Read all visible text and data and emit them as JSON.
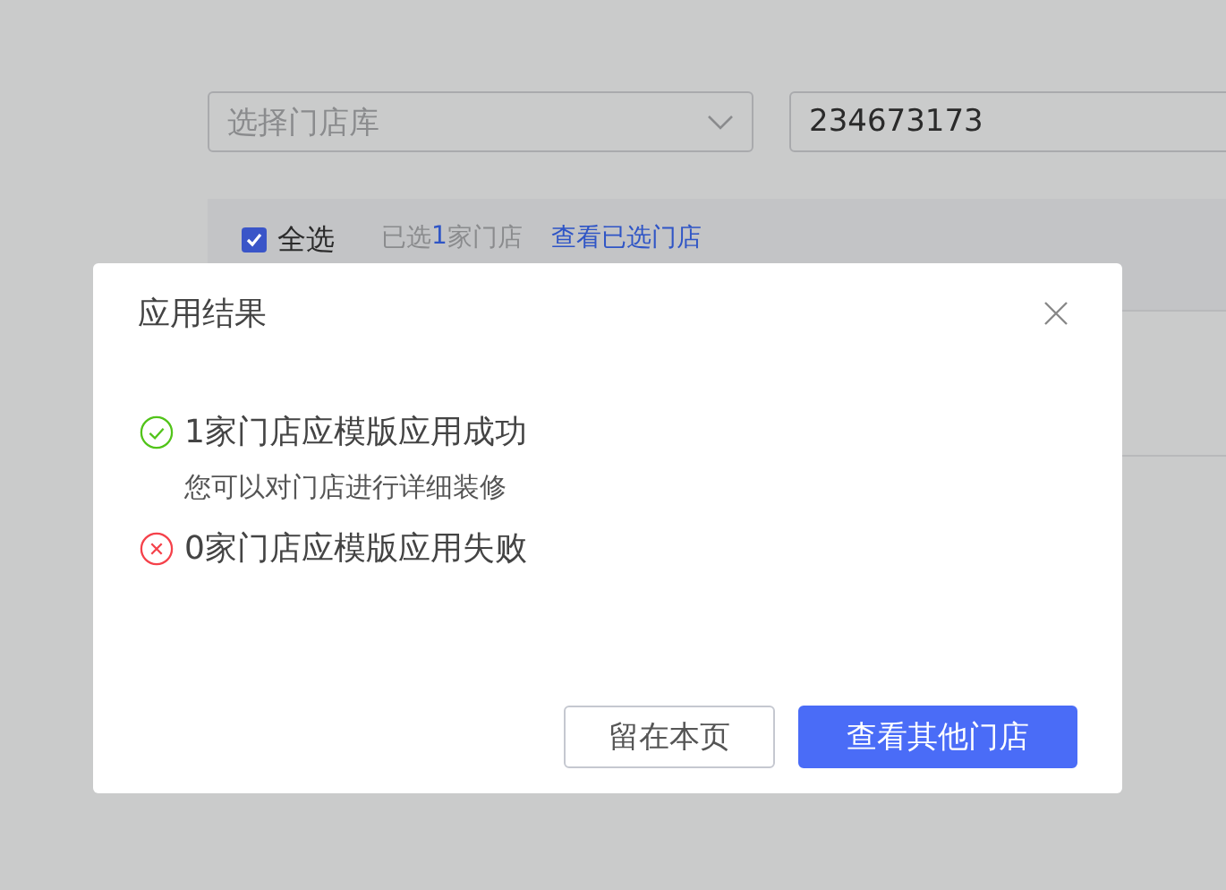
{
  "filters": {
    "store_library_select": {
      "placeholder": "选择门店库"
    },
    "search_input": {
      "value": "234673173"
    }
  },
  "selection_bar": {
    "select_all": {
      "label": "全选",
      "checked": true
    },
    "summary": {
      "prefix": "已选",
      "count": "1",
      "suffix": "家门店"
    },
    "view_selected_link": "查看已选门店"
  },
  "dialog": {
    "title": "应用结果",
    "results": [
      {
        "kind": "success",
        "text": "1家门店应模版应用成功",
        "hint": "您可以对门店进行详细装修"
      },
      {
        "kind": "failure",
        "text": "0家门店应模版应用失败"
      }
    ],
    "buttons": [
      {
        "label": "留在本页",
        "primary": false
      },
      {
        "label": "查看其他门店",
        "primary": true
      }
    ]
  }
}
